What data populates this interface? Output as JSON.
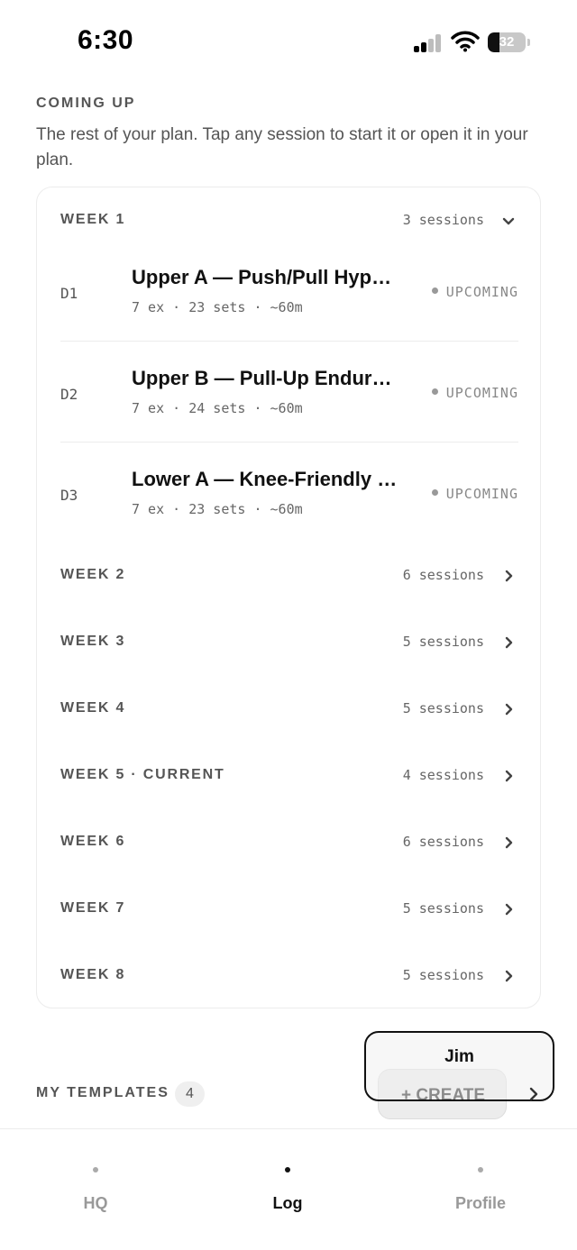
{
  "status_bar": {
    "time": "6:30",
    "battery": "32",
    "battery_level": 0.32
  },
  "coming_up": {
    "label": "COMING UP",
    "description": "The rest of your plan. Tap any session to start it or open it in your plan."
  },
  "plan": {
    "weeks": [
      {
        "title": "WEEK 1",
        "count": "3 sessions",
        "chevron": "chevron-down-icon"
      },
      {
        "title": "WEEK 2",
        "count": "6 sessions",
        "chevron": "chevron-right-icon"
      },
      {
        "title": "WEEK 3",
        "count": "5 sessions",
        "chevron": "chevron-right-icon"
      },
      {
        "title": "WEEK 4",
        "count": "5 sessions",
        "chevron": "chevron-right-icon"
      },
      {
        "title": "WEEK 5 · CURRENT",
        "count": "4 sessions",
        "chevron": "chevron-right-icon"
      },
      {
        "title": "WEEK 6",
        "count": "6 sessions",
        "chevron": "chevron-right-icon"
      },
      {
        "title": "WEEK 7",
        "count": "5 sessions",
        "chevron": "chevron-right-icon"
      },
      {
        "title": "WEEK 8",
        "count": "5 sessions",
        "chevron": "chevron-right-icon"
      }
    ],
    "sessions": [
      {
        "day": "D1",
        "title": "Upper A — Push/Pull Hypertrophy",
        "meta": "7 ex · 23 sets · ~60m",
        "status": "UPCOMING"
      },
      {
        "day": "D2",
        "title": "Upper B — Pull-Up Endurance",
        "meta": "7 ex · 24 sets · ~60m",
        "status": "UPCOMING"
      },
      {
        "day": "D3",
        "title": "Lower A — Knee-Friendly Strength",
        "meta": "7 ex · 23 sets · ~60m",
        "status": "UPCOMING"
      }
    ]
  },
  "templates": {
    "label": "MY TEMPLATES",
    "count": "4",
    "create_label": "+ CREATE",
    "popup_label": "Jim"
  },
  "tab_bar": {
    "tabs": [
      {
        "label": "HQ"
      },
      {
        "label": "Log"
      },
      {
        "label": "Profile"
      }
    ]
  },
  "colors": {
    "text": "#111111",
    "muted": "#555555",
    "border": "#ececec",
    "badge_bg": "#efefef"
  }
}
